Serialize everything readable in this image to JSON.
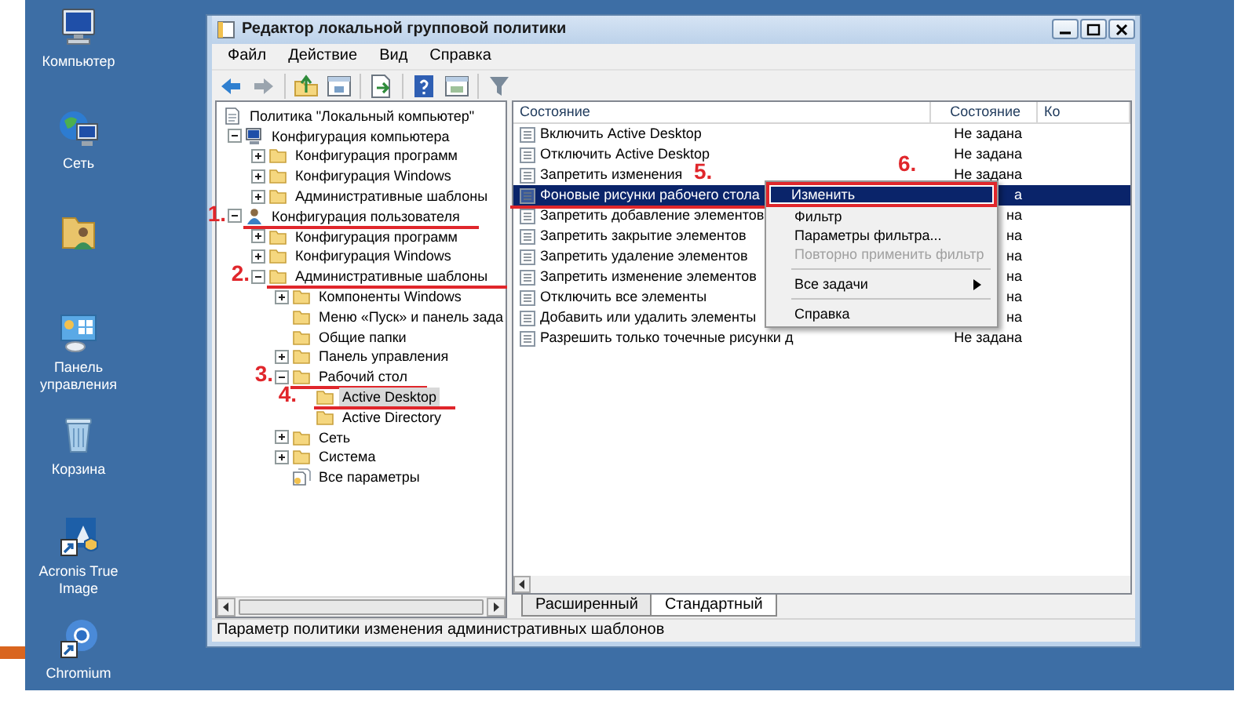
{
  "desktop": {
    "icons": [
      {
        "kind": "computer",
        "label": "Компьютер"
      },
      {
        "kind": "network",
        "label": "Сеть"
      },
      {
        "kind": "user-folder"
      },
      {
        "kind": "control-panel",
        "label": "Панель управления"
      },
      {
        "kind": "recycle-bin",
        "label": "Корзина"
      },
      {
        "kind": "acronis",
        "label": "Acronis True Image"
      },
      {
        "kind": "chromium",
        "label": "Chromium"
      }
    ]
  },
  "window": {
    "title": "Редактор локальной групповой политики",
    "menu": [
      "Файл",
      "Действие",
      "Вид",
      "Справка"
    ],
    "tree": [
      {
        "kind": "policy",
        "label": "Политика \"Локальный компьютер\"",
        "selected": false,
        "children": [
          {
            "kind": "computer",
            "label": "Конфигурация компьютера",
            "expanded": true,
            "selected": false,
            "children": [
              {
                "kind": "folder",
                "label": "Конфигурация программ",
                "expanded": false,
                "selected": false
              },
              {
                "kind": "folder",
                "label": "Конфигурация Windows",
                "expanded": false,
                "selected": false
              },
              {
                "kind": "folder",
                "label": "Административные шаблоны",
                "expanded": false,
                "selected": false
              }
            ]
          },
          {
            "kind": "user",
            "label": "Конфигурация пользователя",
            "expanded": true,
            "selected": false,
            "annotation": "1.",
            "children": [
              {
                "kind": "folder",
                "label": "Конфигурация программ",
                "expanded": false,
                "selected": false
              },
              {
                "kind": "folder",
                "label": "Конфигурация Windows",
                "expanded": false,
                "selected": false
              },
              {
                "kind": "folder",
                "label": "Административные шаблоны",
                "expanded": true,
                "selected": false,
                "annotation": "2.",
                "children": [
                  {
                    "kind": "folder",
                    "label": "Компоненты Windows",
                    "expanded": false,
                    "selected": false
                  },
                  {
                    "kind": "folder",
                    "label": "Меню «Пуск» и панель зада",
                    "selected": false
                  },
                  {
                    "kind": "folder",
                    "label": "Общие папки",
                    "selected": false
                  },
                  {
                    "kind": "folder",
                    "label": "Панель управления",
                    "expanded": false,
                    "selected": false
                  },
                  {
                    "kind": "folder",
                    "label": "Рабочий стол",
                    "expanded": true,
                    "selected": false,
                    "annotation": "3.",
                    "children": [
                      {
                        "kind": "folder",
                        "label": "Active Desktop",
                        "selected": true,
                        "annotation": "4."
                      },
                      {
                        "kind": "folder",
                        "label": "Active Directory",
                        "selected": false
                      }
                    ]
                  },
                  {
                    "kind": "folder",
                    "label": "Сеть",
                    "expanded": false,
                    "selected": false
                  },
                  {
                    "kind": "folder",
                    "label": "Система",
                    "expanded": false,
                    "selected": false
                  },
                  {
                    "kind": "settings",
                    "label": "Все параметры",
                    "selected": false
                  }
                ]
              }
            ]
          }
        ]
      }
    ],
    "list": {
      "columns": [
        "Состояние",
        "Состояние",
        "Ко"
      ],
      "rows": [
        {
          "name": "Включить Active Desktop",
          "state": "Не задана",
          "selected": false
        },
        {
          "name": "Отключить Active Desktop",
          "state": "Не задана",
          "selected": false
        },
        {
          "name": "Запретить изменения",
          "state": "Не задана",
          "selected": false
        },
        {
          "name": "Фоновые рисунки рабочего стола",
          "state": "а",
          "selected": true,
          "annotation": "5."
        },
        {
          "name": "Запретить добавление элементов",
          "state": "на",
          "selected": false
        },
        {
          "name": "Запретить закрытие элементов",
          "state": "на",
          "selected": false
        },
        {
          "name": "Запретить удаление элементов",
          "state": "на",
          "selected": false
        },
        {
          "name": "Запретить изменение элементов",
          "state": "на",
          "selected": false
        },
        {
          "name": "Отключить все элементы",
          "state": "на",
          "selected": false
        },
        {
          "name": "Добавить или удалить элементы",
          "state": "на",
          "selected": false
        },
        {
          "name": "Разрешить только точечные рисунки д",
          "state": "Не задана",
          "selected": false
        }
      ]
    },
    "context_menu": [
      {
        "kind": "item",
        "label": "Изменить",
        "selected": true,
        "disabled": false,
        "annotation": "6."
      },
      {
        "kind": "item",
        "label": "Фильтр",
        "selected": false,
        "disabled": false
      },
      {
        "kind": "item",
        "label": "Параметры фильтра...",
        "selected": false,
        "disabled": false
      },
      {
        "kind": "item",
        "label": "Повторно применить фильтр",
        "selected": false,
        "disabled": true
      },
      {
        "kind": "separator"
      },
      {
        "kind": "item",
        "label": "Все задачи",
        "selected": false,
        "disabled": false,
        "submenu": true
      },
      {
        "kind": "separator"
      },
      {
        "kind": "item",
        "label": "Справка",
        "selected": false,
        "disabled": false
      }
    ],
    "tabs": [
      {
        "label": "Расширенный",
        "selected": false
      },
      {
        "label": "Стандартный",
        "selected": true
      }
    ],
    "status_bar": "Параметр политики изменения административных шаблонов"
  }
}
